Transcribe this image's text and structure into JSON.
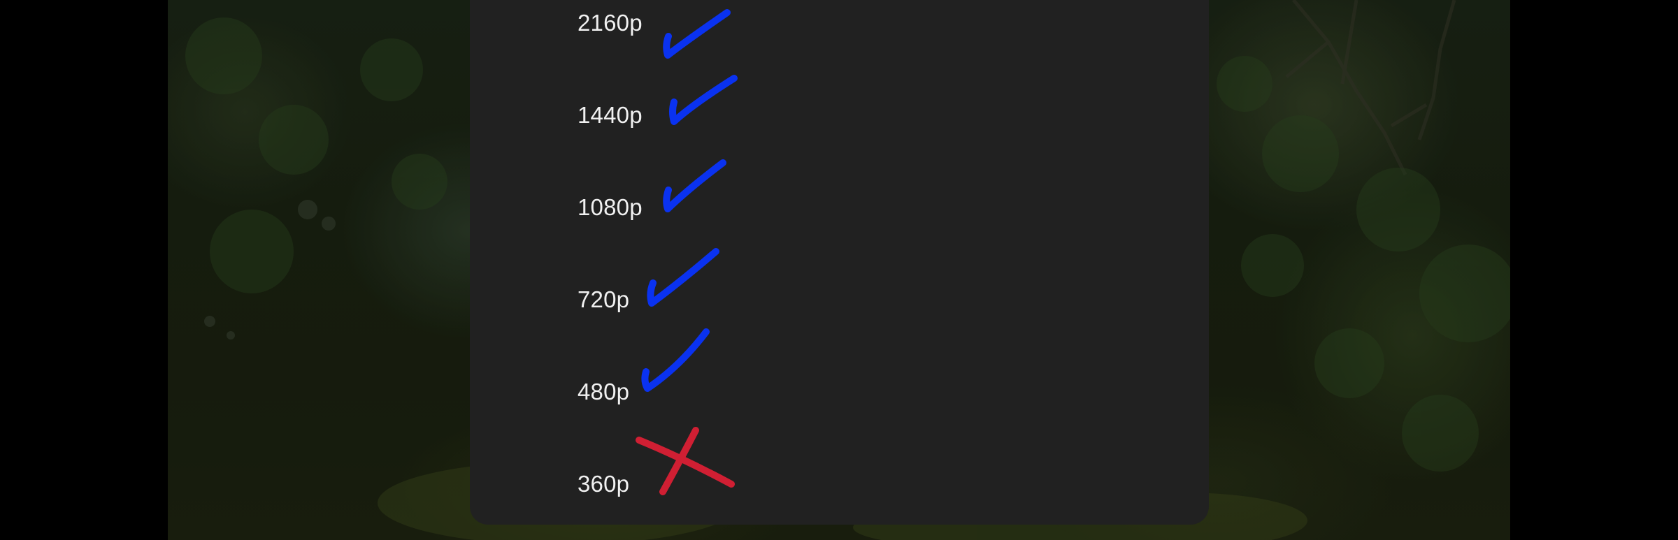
{
  "quality_menu": {
    "options": [
      {
        "label": "2160p",
        "mark": "checkmark-icon",
        "mark_color": "#0a32f0"
      },
      {
        "label": "1440p",
        "mark": "checkmark-icon",
        "mark_color": "#0a32f0"
      },
      {
        "label": "1080p",
        "mark": "checkmark-icon",
        "mark_color": "#0a32f0"
      },
      {
        "label": "720p",
        "mark": "checkmark-icon",
        "mark_color": "#0a32f0"
      },
      {
        "label": "480p",
        "mark": "checkmark-icon",
        "mark_color": "#0a32f0"
      },
      {
        "label": "360p",
        "mark": "cross-icon",
        "mark_color": "#d01f33"
      }
    ]
  },
  "colors": {
    "sheet_background": "#212121",
    "label_text": "#f1f1f1",
    "supported_mark": "#0a32f0",
    "unsupported_mark": "#d01f33"
  }
}
